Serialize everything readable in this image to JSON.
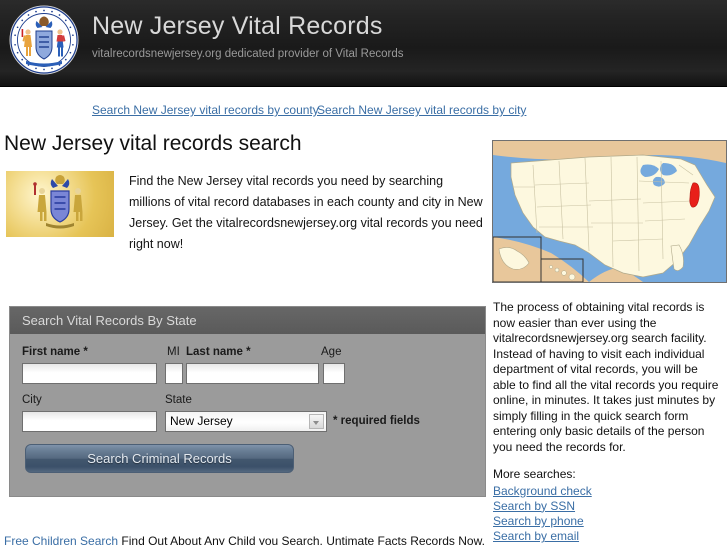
{
  "header": {
    "title": "New Jersey Vital Records",
    "tagline": "vitalrecordsnewjersey.org dedicated provider of Vital Records",
    "logo_icon": "new-jersey-state-seal-icon"
  },
  "nav": {
    "links": [
      {
        "label": "Search New Jersey vital records by county"
      },
      {
        "label": "Search New Jersey vital records by city"
      }
    ]
  },
  "main": {
    "page_title": "New Jersey vital records search",
    "intro_image_icon": "new-jersey-coat-of-arms-image",
    "intro_text": "Find the New Jersey vital records you need by searching millions of vital record databases in each county and city in New Jersey. Get the vitalrecordsnewjersey.org vital records you need right now!"
  },
  "form": {
    "panel_title": "Search Vital Records By State",
    "labels": {
      "first_name": "First name *",
      "mi": "MI",
      "last_name": "Last name *",
      "age": "Age",
      "city": "City",
      "state": "State"
    },
    "values": {
      "first_name": "",
      "mi": "",
      "last_name": "",
      "age": "",
      "city": "",
      "state": "New Jersey"
    },
    "state_options": [
      "New Jersey"
    ],
    "required_note": "* required fields",
    "submit_label": "Search Criminal Records"
  },
  "sidebar": {
    "map_icon": "us-map-new-jersey-highlighted",
    "paragraph": "The process of obtaining vital records is now easier than ever using the vitalrecordsnewjersey.org search facility. Instead of having to visit each individual department of vital records, you will be able to find all the vital records you require online, in minutes. It takes just minutes by simply filling in the quick search form entering only basic details of the person you need the records for.",
    "more_searches_label": "More searches:",
    "links": [
      {
        "label": "Background check"
      },
      {
        "label": "Search by SSN"
      },
      {
        "label": "Search by phone"
      },
      {
        "label": "Search by email"
      }
    ]
  },
  "footer": {
    "link_1": "Free Children Search",
    "text_1": "Find Out About Any Child you Search. Untimate Facts Records Now.",
    "accent_link_color": "#3a6ea5"
  },
  "colors": {
    "header_bg": "#1c1c1c",
    "link": "#3a6ea5",
    "panel_bg": "#9b9b9b",
    "panel_header_bg": "#5e5e5e",
    "button_blue": "#54687f",
    "highlight_state": "#e8201a"
  }
}
